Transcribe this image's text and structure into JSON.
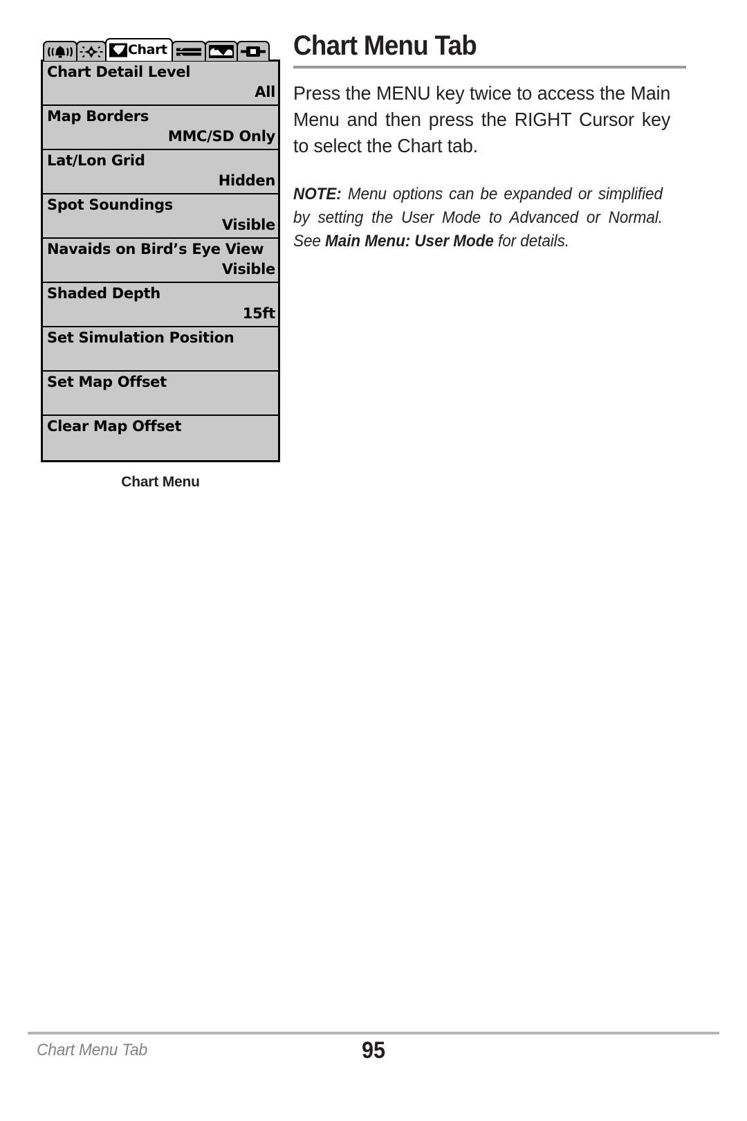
{
  "document": {
    "heading": "Chart Menu Tab",
    "body_paragraph": "Press the MENU key twice to access the Main Menu and then press the RIGHT Cursor key to select the Chart tab.",
    "note": {
      "label": "NOTE:",
      "text_before": " Menu options can be expanded or simplified by setting the User Mode to Advanced or Normal. See ",
      "bold_reference": "Main Menu: User Mode",
      "text_after": " for details."
    }
  },
  "figure": {
    "caption": "Chart Menu",
    "tabs": [
      {
        "icon": "alarm-bell-icon",
        "label": "",
        "active": false
      },
      {
        "icon": "sonar-brightness-icon",
        "label": "",
        "active": false
      },
      {
        "icon": "chart-icon",
        "label": "Chart",
        "active": true
      },
      {
        "icon": "setup-wrench-icon",
        "label": "",
        "active": false
      },
      {
        "icon": "views-icon",
        "label": "",
        "active": false
      },
      {
        "icon": "accessories-icon",
        "label": "",
        "active": false
      }
    ],
    "menu_items": [
      {
        "label": "Chart Detail Level",
        "value": "All"
      },
      {
        "label": "Map Borders",
        "value": "MMC/SD Only"
      },
      {
        "label": "Lat/Lon Grid",
        "value": "Hidden"
      },
      {
        "label": "Spot Soundings",
        "value": "Visible"
      },
      {
        "label": "Navaids on Bird’s Eye View",
        "value": "Visible"
      },
      {
        "label": "Shaded Depth",
        "value": "15ft"
      },
      {
        "label": "Set Simulation Position",
        "value": ""
      },
      {
        "label": "Set Map Offset",
        "value": ""
      },
      {
        "label": "Clear Map Offset",
        "value": ""
      }
    ]
  },
  "footer": {
    "running_title": "Chart Menu Tab",
    "page_number": "95"
  },
  "colors": {
    "lcd_background": "#c9c9c9",
    "lcd_border": "#000000",
    "rule_gray": "#9a9a9a",
    "footer_rule_gray": "#b4b4b4",
    "footer_text_gray": "#808285",
    "ink": "#231f20"
  }
}
